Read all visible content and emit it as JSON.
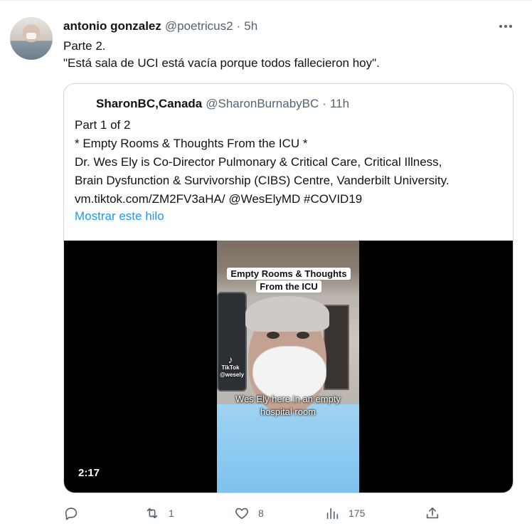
{
  "tweet": {
    "author_name": "antonio gonzalez",
    "author_handle": "@poetricus2",
    "separator": "·",
    "time": "5h",
    "text_line1": "Parte 2.",
    "text_line2": "\"Está sala de UCI está vacía porque todos fallecieron hoy\"."
  },
  "quoted": {
    "author_name": "SharonBC,Canada",
    "author_handle": "@SharonBurnabyBC",
    "separator": "·",
    "time": "11h",
    "lines": [
      "Part 1 of 2",
      "* Empty Rooms & Thoughts From the ICU *",
      "Dr. Wes Ely is Co-Director Pulmonary & Critical Care, Critical Illness,",
      "Brain Dysfunction & Survivorship (CIBS) Centre, Vanderbilt University.",
      "vm.tiktok.com/ZM2FV3aHA/ @WesElyMD #COVID19"
    ],
    "show_thread_label": "Mostrar este hilo",
    "video": {
      "overlay_title_line1": "Empty Rooms & Thoughts",
      "overlay_title_line2": "From the ICU",
      "caption_line1": "Wes Ely here in an empty",
      "caption_line2": "hospital room",
      "watermark": "TikTok",
      "watermark_handle": "@wesely",
      "duration": "2:17"
    }
  },
  "actions": {
    "reply_count": "",
    "retweet_count": "1",
    "like_count": "8",
    "views_count": "175"
  },
  "icons": {
    "more": "more-icon",
    "reply": "reply-icon",
    "retweet": "retweet-icon",
    "like": "heart-icon",
    "views": "views-icon",
    "share": "share-icon"
  }
}
